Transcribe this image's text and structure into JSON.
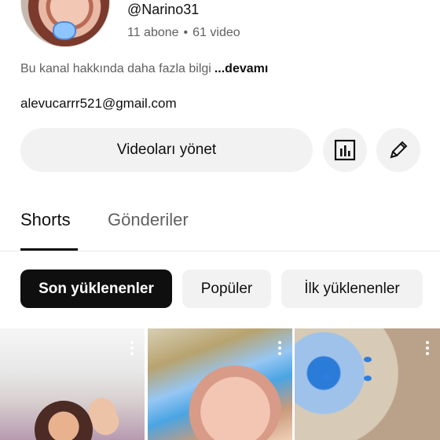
{
  "channel": {
    "handle": "@Narino31",
    "subscribers": "11 abone",
    "separator": "•",
    "videos": "61 video",
    "about_text": "Bu kanal hakkında daha fazla bilgi",
    "about_more": "...devamı",
    "email": "alevucarrr521@gmail.com"
  },
  "actions": {
    "manage_videos_label": "Videoları yönet",
    "stats_icon": "analytics-icon",
    "edit_icon": "edit-pencil-icon"
  },
  "tabs": [
    {
      "label": "Shorts",
      "active": true
    },
    {
      "label": "Gönderiler",
      "active": false
    }
  ],
  "filters": [
    {
      "label": "Son yüklenenler",
      "active": true
    },
    {
      "label": "Popüler",
      "active": false
    },
    {
      "label": "İlk yüklenenler",
      "active": false
    }
  ],
  "shorts": [
    {
      "menu_icon": "more-vert-icon"
    },
    {
      "menu_icon": "more-vert-icon"
    },
    {
      "menu_icon": "more-vert-icon"
    }
  ]
}
